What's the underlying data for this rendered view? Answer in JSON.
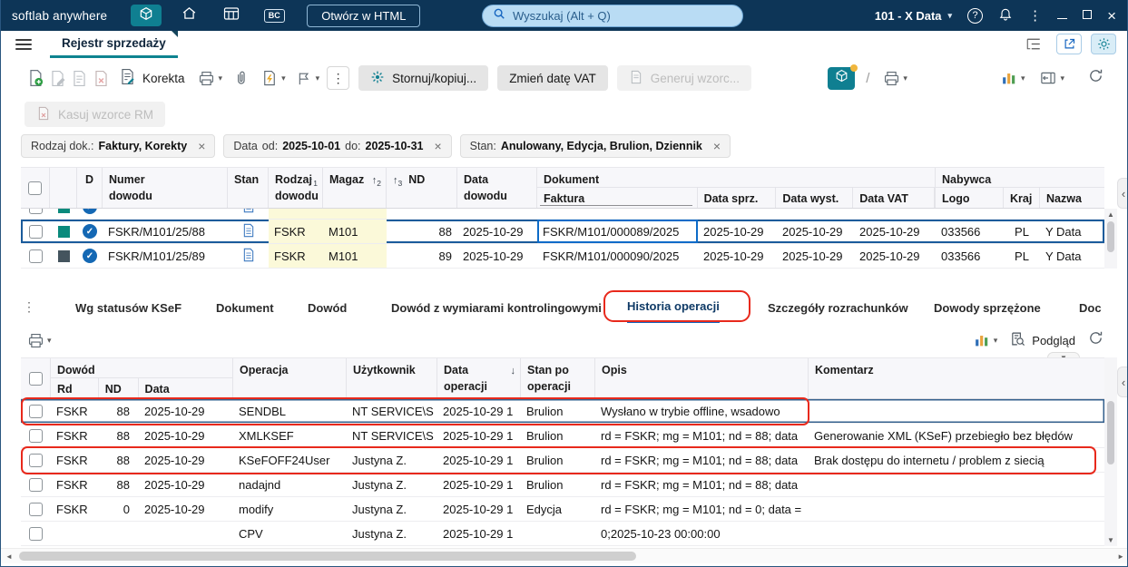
{
  "titlebar": {
    "app_name": "softlab anywhere",
    "bc_label": "BC",
    "open_html_button": "Otwórz w HTML",
    "search_placeholder": "Wyszukaj (Alt + Q)",
    "profile": "101 - X Data"
  },
  "tabbar": {
    "active_tab": "Rejestr sprzedaży"
  },
  "toolbar": {
    "korekta": "Korekta",
    "stornuj": "Stornuj/kopiuj...",
    "zmien_date_vat": "Zmień datę VAT",
    "generuj_wzorce": "Generuj wzorc...",
    "kasuj_wzorce": "Kasuj wzorce RM"
  },
  "filters": {
    "doc": {
      "label": "Rodzaj dok.:",
      "value": "Faktury, Korekty"
    },
    "date": {
      "label": "Data",
      "od_label": "od:",
      "od_value": "2025-10-01",
      "do_label": "do:",
      "do_value": "2025-10-31"
    },
    "stan": {
      "label": "Stan:",
      "value": "Anulowany, Edycja, Brulion, Dziennik"
    }
  },
  "grid_top": {
    "headers": {
      "d": "D",
      "numer_1": "Numer",
      "numer_2": "dowodu",
      "stan": "Stan",
      "rodzaj_1": "Rodzaj",
      "rodzaj_2": "dowodu",
      "rodzaj_sort": "1",
      "magaz": "Magaz",
      "magaz_sort": "2",
      "nd": "ND",
      "nd_sort": "3",
      "data_1": "Data",
      "data_2": "dowodu",
      "dokument": "Dokument",
      "faktura": "Faktura",
      "data_sprz": "Data sprz.",
      "data_wyst": "Data wyst.",
      "data_vat": "Data VAT",
      "nabywca": "Nabywca",
      "logo": "Logo",
      "kraj": "Kraj",
      "nazwa": "Nazwa"
    },
    "rows": [
      {
        "numer": "FSKR/M101/25/88",
        "rodzaj": "FSKR",
        "magaz": "M101",
        "nd": "88",
        "data": "2025-10-29",
        "faktura": "FSKR/M101/000089/2025",
        "data_sprz": "2025-10-29",
        "data_wyst": "2025-10-29",
        "data_vat": "2025-10-29",
        "logo": "033566",
        "kraj": "PL",
        "nazwa": "Y Data"
      },
      {
        "numer": "FSKR/M101/25/89",
        "rodzaj": "FSKR",
        "magaz": "M101",
        "nd": "89",
        "data": "2025-10-29",
        "faktura": "FSKR/M101/000090/2025",
        "data_sprz": "2025-10-29",
        "data_wyst": "2025-10-29",
        "data_vat": "2025-10-29",
        "logo": "033566",
        "kraj": "PL",
        "nazwa": "Y Data"
      }
    ]
  },
  "bottom_tabs": {
    "items": [
      "Wg statusów KSeF",
      "Dokument",
      "Dowód",
      "Dowód z wymiarami kontrolingowymi",
      "Historia operacji",
      "Szczegóły rozrachunków",
      "Dowody sprzężone",
      "Doc"
    ]
  },
  "bottom_toolbar": {
    "podglad": "Podgląd"
  },
  "grid_bottom": {
    "headers": {
      "dowod": "Dowód",
      "rd": "Rd",
      "nd": "ND",
      "data": "Data",
      "operacja": "Operacja",
      "uzytkownik": "Użytkownik",
      "data_op_1": "Data",
      "data_op_2": "operacji",
      "stan_po_1": "Stan po",
      "stan_po_2": "operacji",
      "opis": "Opis",
      "komentarz": "Komentarz"
    },
    "rows": [
      {
        "rd": "FSKR",
        "nd": "88",
        "data": "2025-10-29",
        "operacja": "SENDBL",
        "uzytkownik": "NT SERVICE\\S",
        "data_op": "2025-10-29 1",
        "stan": "Brulion",
        "opis": "Wysłano w trybie offline, wsadowo",
        "komentarz": ""
      },
      {
        "rd": "FSKR",
        "nd": "88",
        "data": "2025-10-29",
        "operacja": "XMLKSEF",
        "uzytkownik": "NT SERVICE\\S",
        "data_op": "2025-10-29 1",
        "stan": "Brulion",
        "opis": "rd = FSKR; mg = M101; nd = 88; data",
        "komentarz": "Generowanie XML (KSeF) przebiegło bez błędów"
      },
      {
        "rd": "FSKR",
        "nd": "88",
        "data": "2025-10-29",
        "operacja": "KSeFOFF24User",
        "uzytkownik": "Justyna Z.",
        "data_op": "2025-10-29 1",
        "stan": "Brulion",
        "opis": "rd = FSKR; mg = M101; nd = 88; data",
        "komentarz": "Brak dostępu do internetu / problem z siecią"
      },
      {
        "rd": "FSKR",
        "nd": "88",
        "data": "2025-10-29",
        "operacja": "nadajnd",
        "uzytkownik": "Justyna Z.",
        "data_op": "2025-10-29 1",
        "stan": "Brulion",
        "opis": "rd = FSKR; mg = M101; nd = 88; data",
        "komentarz": ""
      },
      {
        "rd": "FSKR",
        "nd": "0",
        "data": "2025-10-29",
        "operacja": "modify",
        "uzytkownik": "Justyna Z.",
        "data_op": "2025-10-29 1",
        "stan": "Edycja",
        "opis": "rd = FSKR; mg = M101; nd = 0; data =",
        "komentarz": ""
      },
      {
        "rd": "",
        "nd": "",
        "data": "",
        "operacja": "CPV",
        "uzytkownik": "Justyna Z.",
        "data_op": "2025-10-29 1",
        "stan": "",
        "opis": "0;2025-10-23 00:00:00",
        "komentarz": ""
      }
    ]
  },
  "colors": {
    "titlebar_bg": "#0d3557",
    "accent_teal": "#0e7f91",
    "selection_blue": "#1a5b9b",
    "focus_cell_blue": "#0d6bc8",
    "annotation_red": "#e8291c",
    "row_highlight_yellow": "#fbf9d9"
  }
}
